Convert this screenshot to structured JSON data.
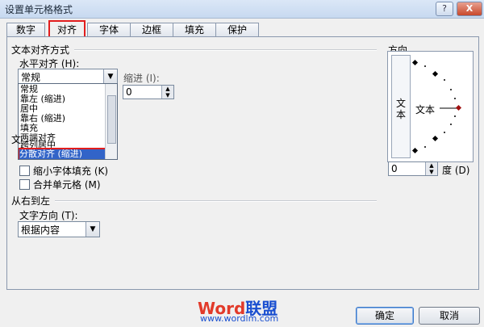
{
  "window": {
    "title": "设置单元格格式",
    "help": "?",
    "close": "X"
  },
  "tabs": [
    "数字",
    "对齐",
    "字体",
    "边框",
    "填充",
    "保护"
  ],
  "text_align": {
    "group": "文本对齐方式",
    "horizontal_label": "水平对齐 (H):",
    "horizontal_value": "常规",
    "horizontal_options": [
      "常规",
      "靠左 (缩进)",
      "居中",
      "靠右 (缩进)",
      "填充",
      "两端对齐",
      "跨列居中",
      "分散对齐 (缩进)"
    ],
    "selected_option": "分散对齐 (缩进)",
    "indent_label": "缩进 (I):",
    "indent_value": "0"
  },
  "text_control": {
    "group_partial": "文",
    "shrink_label": "缩小字体填充 (K)",
    "merge_label": "合并单元格 (M)"
  },
  "rtl": {
    "group": "从右到左",
    "direction_label": "文字方向 (T):",
    "direction_value": "根据内容"
  },
  "orientation": {
    "group": "方向",
    "vertical_text": "文本",
    "dial_text": "文本",
    "degree_value": "0",
    "degree_label": "度 (D)"
  },
  "buttons": {
    "ok": "确定",
    "cancel": "取消"
  },
  "watermark": {
    "word": "Word",
    "union": "联盟",
    "url": "www.wordlm.com"
  }
}
